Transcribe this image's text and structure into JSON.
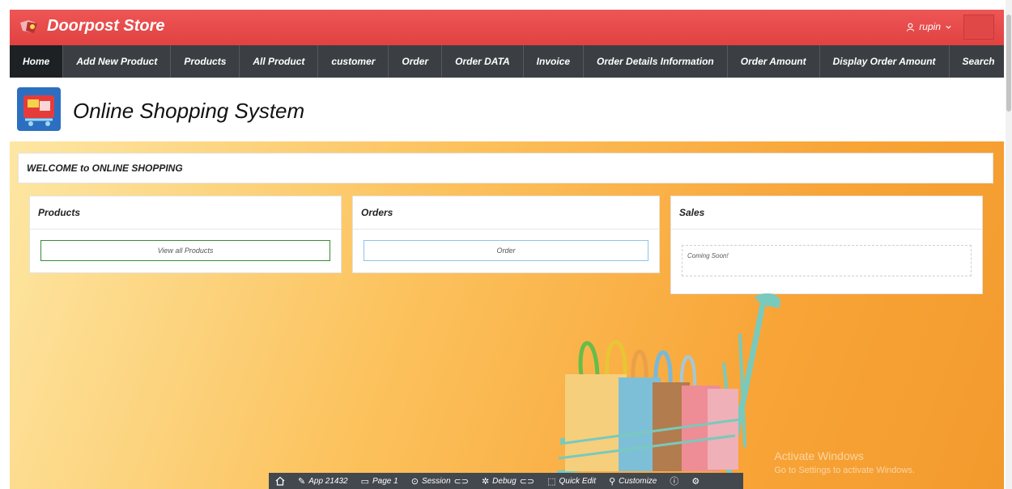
{
  "app": {
    "brand": "Doorpost Store",
    "user": "rupin",
    "title": "Online Shopping System"
  },
  "nav": {
    "items": [
      {
        "label": "Home",
        "active": true
      },
      {
        "label": "Add New Product"
      },
      {
        "label": "Products"
      },
      {
        "label": "All Product"
      },
      {
        "label": "customer"
      },
      {
        "label": "Order"
      },
      {
        "label": "Order DATA"
      },
      {
        "label": "Invoice"
      },
      {
        "label": "Order Details Information"
      },
      {
        "label": "Order Amount"
      },
      {
        "label": "Display Order Amount"
      },
      {
        "label": "Search"
      }
    ],
    "more_icon": "chevron-down-icon"
  },
  "welcome": "WELCOME to ONLINE SHOPPING",
  "cards": {
    "products": {
      "title": "Products",
      "button": "View all Products"
    },
    "orders": {
      "title": "Orders",
      "button": "Order"
    },
    "sales": {
      "title": "Sales",
      "text": "Coming Soon!"
    }
  },
  "watermark": {
    "line1": "Activate Windows",
    "line2": "Go to Settings to activate Windows."
  },
  "devbar": {
    "app": "App 21432",
    "page": "Page 1",
    "session": "Session",
    "debug": "Debug",
    "quick_edit": "Quick Edit",
    "customize": "Customize"
  },
  "colors": {
    "header": "#e84848",
    "nav": "#3b3f44",
    "products_button_border": "#3a8a3a",
    "orders_button_border": "#8cc4e8"
  }
}
